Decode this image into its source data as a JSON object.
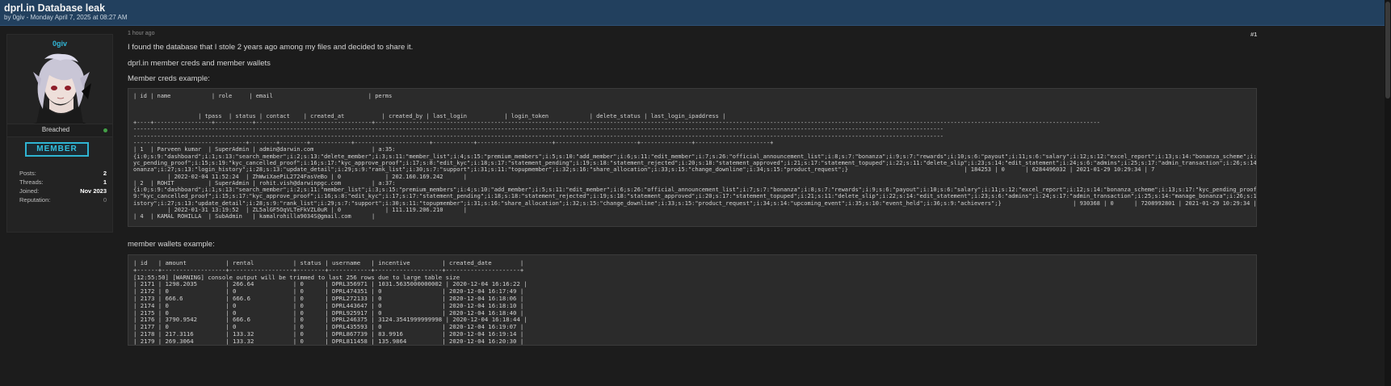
{
  "thread": {
    "title": "dprl.in Database leak",
    "subtitle": "by 0giv - Monday April 7, 2025 at 08:27 AM"
  },
  "author": {
    "username": "0giv",
    "status": "Breached",
    "rank": "MEMBER",
    "stats": [
      {
        "label": "Posts:",
        "value": "2"
      },
      {
        "label": "Threads:",
        "value": "1"
      },
      {
        "label": "Joined:",
        "value": "Nov 2023"
      },
      {
        "label": "Reputation:",
        "value": "0"
      }
    ],
    "colors": {
      "username": "#31b7d8",
      "rank_border": "#2fb4d2",
      "online": "#43a047"
    }
  },
  "post": {
    "time": "1 hour ago",
    "number": "#1",
    "intro": "I found the database that I stole 2 years ago among my files and decided to share it.",
    "subject": "dprl.in member creds and member wallets",
    "creds_heading": "Member creds example:",
    "wallets_heading": "member wallets example:",
    "creds_code": "| id | name            | role     | email                            | perms\n\n\n                   | tpass  | status | contact    | created_at           | created_by | last_login           | login_token            | delete_status | last_login_ipaddress |\n+----+-----------------+-----------+----------------------------------+---------------------------------------------------------------------------------------------------------------------------------------------------------------------------------------------------------------------\n----------------------------------------------------------------------------------------------------------------------------------------------------------------------------------------------------------------------------------------------\n----------------------------------------------------------------------------------------------------------------------------------------------------------------------------------------------------------------------------------------------\n---------------------------------+--------+--------+------------+----------------------+------------+----------------------+------------------------+---------------+----------------------+\n| 1  | Parveen kumar  | SuperAdmin | admin@darwin.com                 | a:35:\n{i:0;s:9:\"dashboard\";i:1;s:13:\"search_member\";i:2;s:13:\"delete_member\";i:3;s:11:\"member_list\";i:4;s:15:\"premium_members\";i:5;s:10:\"add_member\";i:6;s:11:\"edit_member\";i:7;s:26:\"official_announcement_list\";i:8;s:7:\"bonanza\";i:9;s:7:\"rewards\";i:10;s:6:\"payout\";i:11;s:6:\"salary\";i:12;s:12:\"excel_report\";i:13;s:14:\"bonanza_scheme\";i:14;s:17:\"k\nyc_pending_proof\";i:15;s:19:\"kyc_cancelled_proof\";i:16;s:17:\"kyc_approve_proof\";i:17;s:8:\"edit_kyc\";i:18;s:17:\"statement_pending\";i:19;s:18:\"statement_rejected\";i:20;s:18:\"statement_approved\";i:21;s:17:\"statement_topuped\";i:22;s:11:\"delete_slip\";i:23;s:14:\"edit_statement\";i:24;s:6:\"admins\";i:25;s:17:\"admin_transaction\";i:26;s:14:\"manage_b\nonanza\";i:27;s:13:\"login_history\";i:28;s:13:\"update_detail\";i:29;s:9:\"rank_list\";i:30;s:7:\"support\";i:31;s:11:\"topupmember\";i:32;s:16:\"share_allocation\";i:33;s:15:\"change_downline\";i:34;s:15:\"product_request\";}                                  | 184253 | 0      | 6284496032 | 2021-01-29 10:29:34 | 7\n          | 2022-02-04 11:52:24  | ZhWwiXaePiL2724FasVeBo | 0             | 202.160.169.242      |\n| 2  | ROHIT          | SuperAdmin | rohit.vish@darwinpgc.com         | a:37:\n{i:0;s:9:\"dashboard\";i:1;s:13:\"search_member\";i:2;s:11:\"member_list\";i:3;s:15:\"premium_members\";i:4;s:10:\"add_member\";i:5;s:11:\"edit_member\";i:6;s:26:\"official_announcement_list\";i:7;s:7:\"bonanza\";i:8;s:7:\"rewards\";i:9;s:6:\"payout\";i:10;s:6:\"salary\";i:11;s:12:\"excel_report\";i:12;s:14:\"bonanza_scheme\";i:13;s:17:\"kyc_pending_proof\";i:14;s:1\n9:\"kyc_cancelled_proof\";i:15;s:17:\"kyc_approve_proof\";i:16;s:8:\"edit_kyc\";i:17;s:17:\"statement_pending\";i:18;s:18:\"statement_rejected\";i:19;s:18:\"statement_approved\";i:20;s:17:\"statement_topuped\";i:21;s:11:\"delete_slip\";i:22;s:14:\"edit_statement\";i:23;s:6:\"admins\";i:24;s:17:\"admin_transaction\";i:25;s:14:\"manage_bonanza\";i:26;s:13:\"login_h\nistory\";i:27;s:13:\"update_detail\";i:28;s:9:\"rank_list\";i:29;s:7:\"support\";i:30;s:11:\"topupmember\";i:31;s:16:\"share_allocation\";i:32;s:15:\"change_downline\";i:33;s:15:\"product_request\";i:34;s:14:\"upcoming_event\";i:35;s:10:\"event_held\";i:36;s:9:\"achievers\";}                     | 930368 | 0      | 7208992801 | 2021-01-29 10:29:34 | 7\n          | 2022-01-31 13:19:52  | ZL5alGF5OqVLTeFkVZL0uR | 0             | 111.119.206.210      |\n| 4  | KAMAL ROHILLA  | SubAdmin   | kamalrohilla9034S@gmail.com      |",
    "wallets_code": "| id   | amount           | rental           | status | username   | incentive         | created_date        |\n+------+------------------+------------------+--------+------------+-------------------+---------------------+\n[12:55:50] [WARNING] console output will be trimmed to last 256 rows due to large table size\n| 2171 | 1298.2035        | 266.64           | 0      | DPRL356971 | 1031.5635000000002 | 2020-12-04 16:16:22 |\n| 2172 | 0                | 0                | 0      | DPRL474351 | 0                 | 2020-12-04 16:17:49 |\n| 2173 | 666.6            | 666.6            | 0      | DPRL272133 | 0                 | 2020-12-04 16:18:06 |\n| 2174 | 0                | 0                | 0      | DPRL443647 | 0                 | 2020-12-04 16:18:10 |\n| 2175 | 0                | 0                | 0      | DPRL925917 | 0                 | 2020-12-04 16:18:40 |\n| 2176 | 3790.9542        | 666.6            | 0      | DPRL246375 | 3124.3541999999998 | 2020-12-04 16:18:44 |\n| 2177 | 0                | 0                | 0      | DPRL435593 | 0                 | 2020-12-04 16:19:07 |\n| 2178 | 217.3116         | 133.32           | 0      | DPRL867739 | 83.9916           | 2020-12-04 16:19:14 |\n| 2179 | 269.3064         | 133.32           | 0      | DPRL811458 | 135.9864          | 2020-12-04 16:20:30 |"
  }
}
